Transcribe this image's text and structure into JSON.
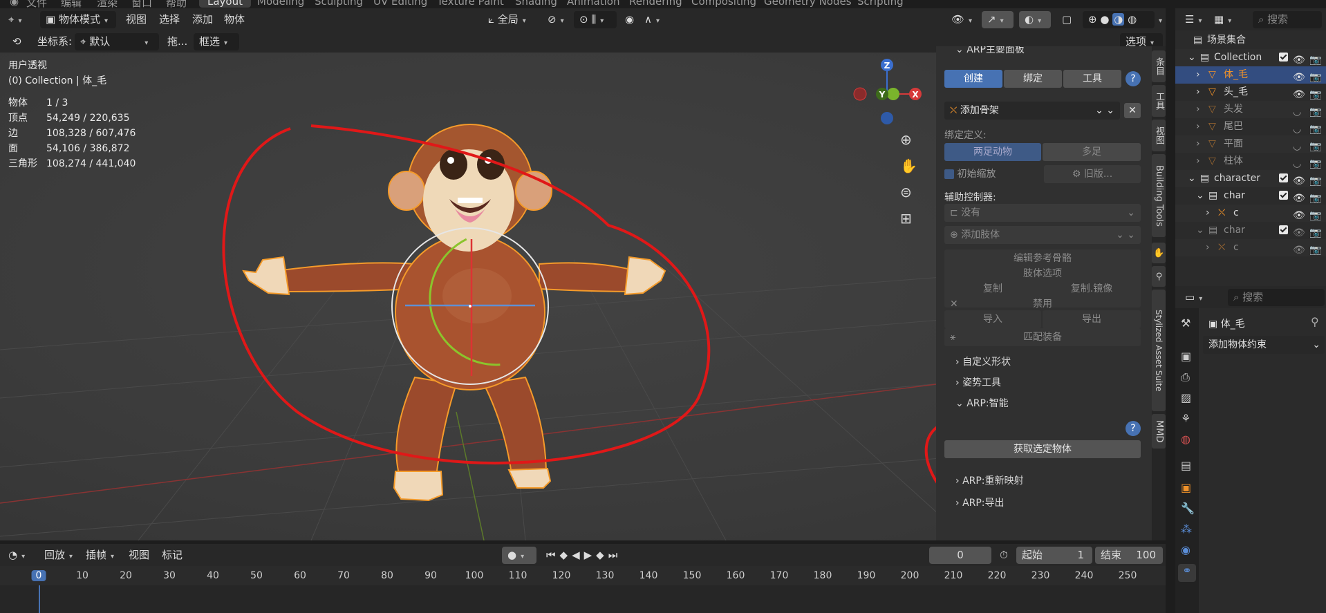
{
  "top_menu": {
    "items": [
      "文件",
      "编辑",
      "渲染",
      "窗口",
      "帮助"
    ],
    "workspace_tabs": [
      "Layout",
      "Modeling",
      "Sculpting",
      "UV Editing",
      "Texture Paint",
      "Shading",
      "Animation",
      "Rendering",
      "Compositing",
      "Geometry Nodes",
      "Scripting"
    ],
    "active_tab": "Layout"
  },
  "viewport_header": {
    "mode": "物体模式",
    "menus": [
      "视图",
      "选择",
      "添加",
      "物体"
    ],
    "transform_orientation": "全局",
    "coord_label": "坐标系:",
    "coord_value": "默认",
    "drag_label": "拖...",
    "select_mode": "框选",
    "options_label": "选项"
  },
  "viewport_info": {
    "perspective": "用户透视",
    "collection_path": "(0) Collection | 体_毛",
    "stats": [
      {
        "label": "物体",
        "value": "1 / 3"
      },
      {
        "label": "顶点",
        "value": "54,249 / 220,635"
      },
      {
        "label": "边",
        "value": "108,328 / 607,476"
      },
      {
        "label": "面",
        "value": "54,106 / 386,872"
      },
      {
        "label": "三角形",
        "value": "108,274 / 441,040"
      }
    ]
  },
  "gizmo": {
    "z": "Z",
    "y": "Y",
    "x": "X"
  },
  "arp_panel": {
    "title": "ARP主要面板",
    "tabs": [
      "创建",
      "绑定",
      "工具"
    ],
    "active_tab": "创建",
    "add_armature": "添加骨架",
    "rig_def_label": "绑定定义:",
    "rig_types": [
      "两足动物",
      "多足"
    ],
    "init_scale": "初始缩放",
    "legacy": "旧版...",
    "helper_ctrl_label": "辅助控制器:",
    "helper_ctrl_value": "没有",
    "add_limb": "添加肢体",
    "edit_ref_bones": "编辑参考骨骼",
    "limb_options": "肢体选项",
    "copy": "复制",
    "copy_mirror": "复制.镜像",
    "disable": "禁用",
    "import": "导入",
    "export": "导出",
    "match_rig": "匹配装备",
    "custom_shapes": "自定义形状",
    "pose_tools": "姿势工具",
    "smart": "ARP:智能",
    "get_selected": "获取选定物体",
    "remap": "ARP:重新映射",
    "export_section": "ARP:导出"
  },
  "side_tabs": [
    "条目",
    "工具",
    "视图",
    "Building Tools",
    "Stylized Asset Suite",
    "MMD"
  ],
  "outliner": {
    "search_placeholder": "搜索",
    "root": "场景集合",
    "rows": [
      {
        "name": "Collection",
        "level": 1,
        "type": "collection",
        "selected": false
      },
      {
        "name": "体_毛",
        "level": 2,
        "type": "mesh",
        "selected": true
      },
      {
        "name": "头_毛",
        "level": 2,
        "type": "mesh",
        "selected": false
      },
      {
        "name": "头发",
        "level": 2,
        "type": "mesh",
        "selected": false
      },
      {
        "name": "尾巴",
        "level": 2,
        "type": "mesh",
        "selected": false
      },
      {
        "name": "平面",
        "level": 2,
        "type": "mesh",
        "selected": false
      },
      {
        "name": "柱体",
        "level": 2,
        "type": "mesh",
        "selected": false
      },
      {
        "name": "character",
        "level": 1,
        "type": "collection",
        "selected": false
      },
      {
        "name": "char",
        "level": 2,
        "type": "collection",
        "selected": false
      },
      {
        "name": "c",
        "level": 3,
        "type": "armature",
        "selected": false
      },
      {
        "name": "char",
        "level": 2,
        "type": "collection",
        "selected": false
      },
      {
        "name": "c",
        "level": 3,
        "type": "armature",
        "selected": false
      }
    ]
  },
  "properties": {
    "search_placeholder": "搜索",
    "object_name": "体_毛",
    "add_constraint": "添加物体约束"
  },
  "timeline": {
    "playback": "回放",
    "keying": "插帧",
    "view": "视图",
    "marker": "标记",
    "current_frame": "0",
    "start_label": "起始",
    "start_value": "1",
    "end_label": "结束",
    "end_value": "100",
    "ticks": [
      "0",
      "10",
      "20",
      "30",
      "40",
      "50",
      "60",
      "70",
      "80",
      "90",
      "100",
      "110",
      "120",
      "130",
      "140",
      "150",
      "160",
      "170",
      "180",
      "190",
      "200",
      "210",
      "220",
      "230",
      "240",
      "250"
    ]
  },
  "colors": {
    "accent_blue": "#4772b3",
    "selection_orange": "#f0922a",
    "annotation_red": "#e01818"
  }
}
